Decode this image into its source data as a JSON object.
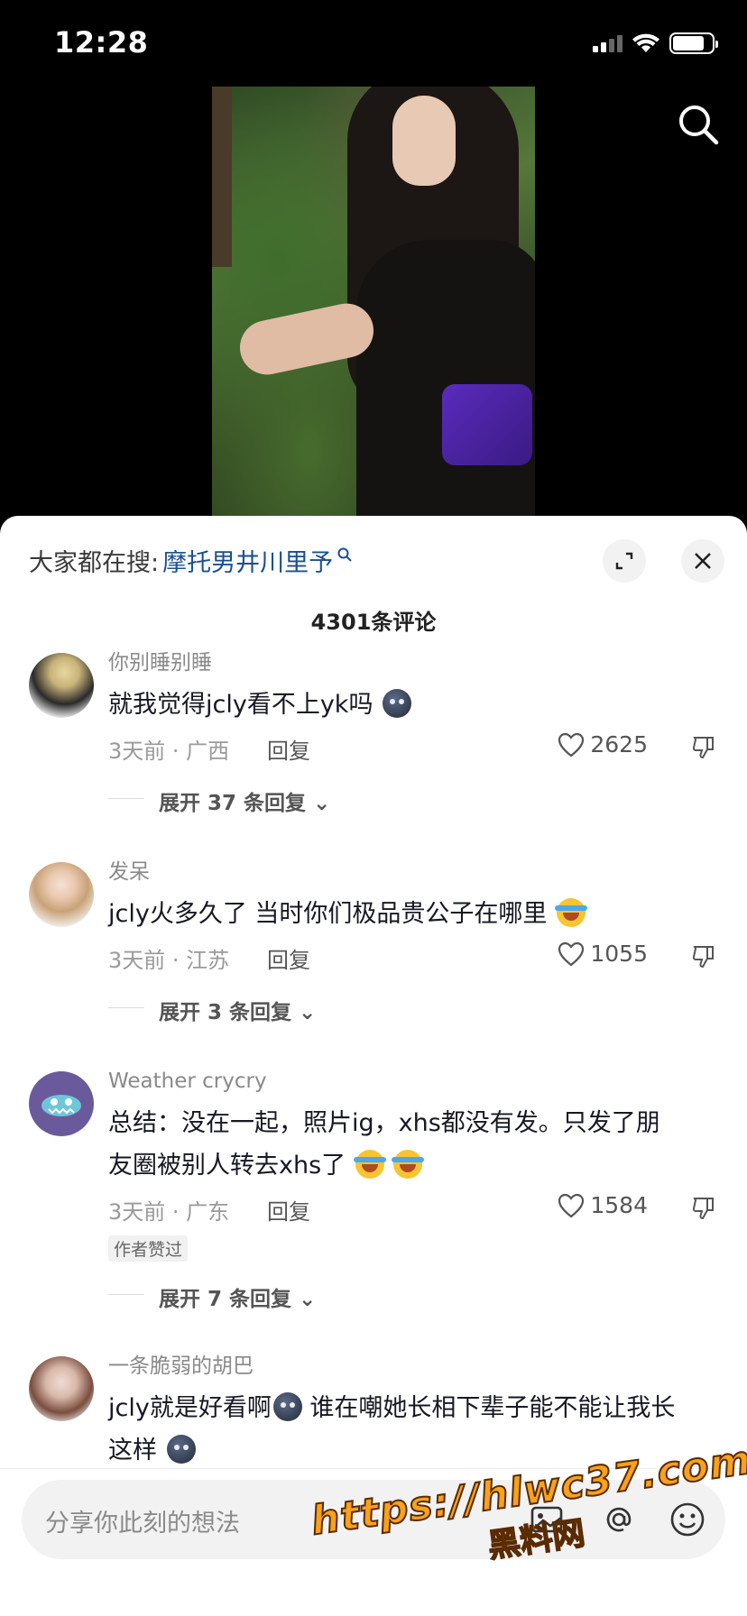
{
  "status_bar": {
    "time": "12:28"
  },
  "video": {
    "search_icon": "search-icon"
  },
  "sheet": {
    "hot_search_prefix": "大家都在搜:",
    "hot_search_term": "摩托男井川里予",
    "comment_count": "4301条评论"
  },
  "comments": [
    {
      "user": "你别睡别睡",
      "text": "就我觉得jcly看不上yk吗",
      "emoji": [
        "dark-face-emoji"
      ],
      "time_loc": "3天前 · 广西",
      "reply": "回复",
      "likes": "2625",
      "expand": "展开 37 条回复"
    },
    {
      "user": "发呆",
      "text": "jcly火多久了 当时你们极品贵公子在哪里",
      "emoji": [
        "laugh-cry-emoji"
      ],
      "time_loc": "3天前 · 江苏",
      "reply": "回复",
      "likes": "1055",
      "expand": "展开 3 条回复"
    },
    {
      "user": "Weather crycry",
      "text_line1": "总结：没在一起，照片ig，xhs都没有发。只发了朋",
      "text_line2": "友圈被别人转去xhs了",
      "emoji": [
        "laugh-cry-emoji",
        "laugh-cry-emoji"
      ],
      "time_loc": "3天前 · 广东",
      "reply": "回复",
      "likes": "1584",
      "author_liked": "作者赞过",
      "expand": "展开 7 条回复"
    },
    {
      "user": "一条脆弱的胡巴",
      "text_part1": "jcly就是好看啊",
      "text_part2": "谁在嘲她长相下辈子能不能让我长",
      "text_line2": "这样",
      "emoji": [
        "dark-face-emoji",
        "dark-face-emoji"
      ]
    }
  ],
  "input": {
    "placeholder": "分享你此刻的想法"
  },
  "watermark": {
    "line1": "https://hlwc37.com",
    "line2": "黑料网"
  }
}
